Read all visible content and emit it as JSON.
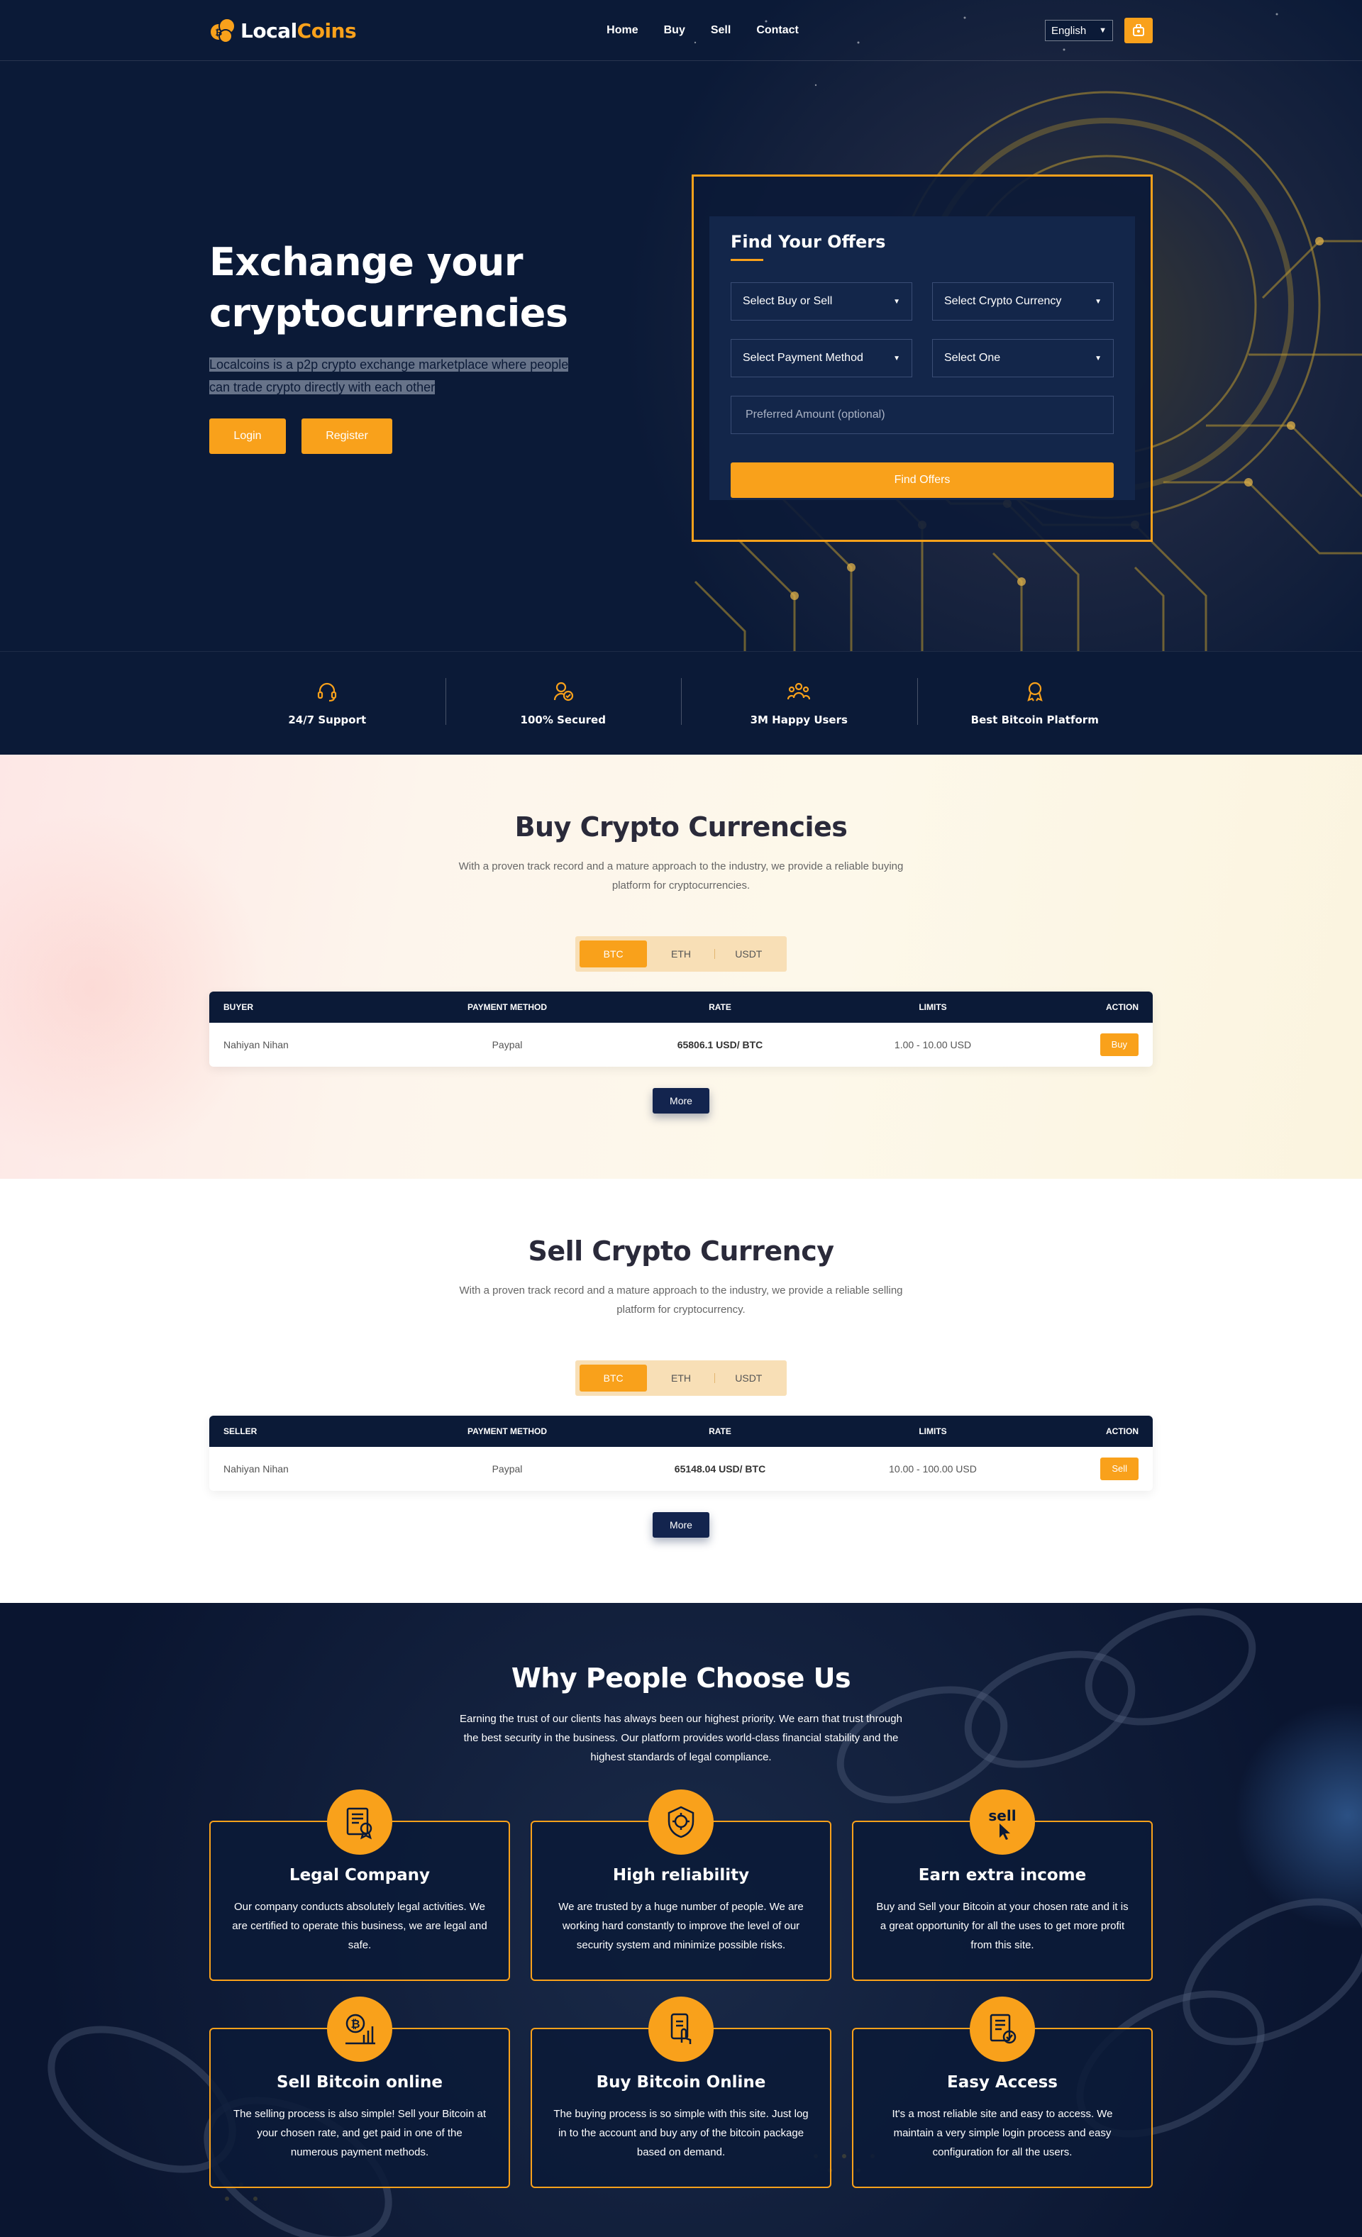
{
  "brand": {
    "part1": "Local",
    "part2": "Coins"
  },
  "nav": {
    "items": [
      "Home",
      "Buy",
      "Sell",
      "Contact"
    ],
    "language": "English"
  },
  "hero": {
    "title_line1": "Exchange your",
    "title_line2": "cryptocurrencies",
    "description": "Localcoins is a p2p crypto exchange marketplace where people can trade crypto directly with each other",
    "login_label": "Login",
    "register_label": "Register"
  },
  "finder": {
    "title": "Find Your Offers",
    "buy_sell": "Select Buy or Sell",
    "currency": "Select Crypto Currency",
    "payment": "Select Payment Method",
    "one": "Select One",
    "amount_placeholder": "Preferred Amount (optional)",
    "button": "Find Offers"
  },
  "features": [
    "24/7 Support",
    "100% Secured",
    "3M Happy Users",
    "Best Bitcoin Platform"
  ],
  "buy": {
    "title": "Buy Crypto Currencies",
    "subtitle": "With a proven track record and a mature approach to the industry, we provide a reliable buying platform for cryptocurrencies.",
    "tabs": [
      "BTC",
      "ETH",
      "USDT"
    ],
    "headers": [
      "Buyer",
      "Payment Method",
      "Rate",
      "Limits",
      "Action"
    ],
    "rows": [
      {
        "name": "Nahiyan Nihan",
        "method": "Paypal",
        "rate": "65806.1 USD/ BTC",
        "limits": "1.00 - 10.00 USD",
        "action": "Buy"
      }
    ],
    "more": "More"
  },
  "sell": {
    "title": "Sell Crypto Currency",
    "subtitle": "With a proven track record and a mature approach to the industry, we provide a reliable selling platform for cryptocurrency.",
    "tabs": [
      "BTC",
      "ETH",
      "USDT"
    ],
    "headers": [
      "Seller",
      "Payment Method",
      "Rate",
      "Limits",
      "Action"
    ],
    "rows": [
      {
        "name": "Nahiyan Nihan",
        "method": "Paypal",
        "rate": "65148.04 USD/ BTC",
        "limits": "10.00 - 100.00 USD",
        "action": "Sell"
      }
    ],
    "more": "More"
  },
  "why": {
    "title": "Why People Choose Us",
    "subtitle": "Earning the trust of our clients has always been our highest priority. We earn that trust through the best security in the business. Our platform provides world-class financial stability and the highest standards of legal compliance.",
    "cards": [
      {
        "title": "Legal Company",
        "text": "Our company conducts absolutely legal activities. We are certified to operate this business, we are legal and safe.",
        "icon": "certificate-icon"
      },
      {
        "title": "High reliability",
        "text": "We are trusted by a huge number of people. We are working hard constantly to improve the level of our security system and minimize possible risks.",
        "icon": "shield-target-icon"
      },
      {
        "title": "Earn extra income",
        "text": "Buy and Sell your Bitcoin at your chosen rate and it is a great opportunity for all the uses to get more profit from this site.",
        "icon": "sell-cursor-icon",
        "icon_text": "sell"
      },
      {
        "title": "Sell Bitcoin online",
        "text": "The selling process is also simple! Sell your Bitcoin at your chosen rate, and get paid in one of the numerous payment methods.",
        "icon": "bitcoin-chart-icon"
      },
      {
        "title": "Buy Bitcoin Online",
        "text": "The buying process is so simple with this site. Just log in to the account and buy any of the bitcoin package based on demand.",
        "icon": "mobile-tap-icon"
      },
      {
        "title": "Easy Access",
        "text": "It's a most reliable site and easy to access. We maintain a very simple login process and easy configuration for all the users.",
        "icon": "document-check-icon"
      }
    ]
  },
  "colors": {
    "accent": "#f9a11b",
    "navy": "#0b1a37",
    "navy_button": "#13244e"
  }
}
